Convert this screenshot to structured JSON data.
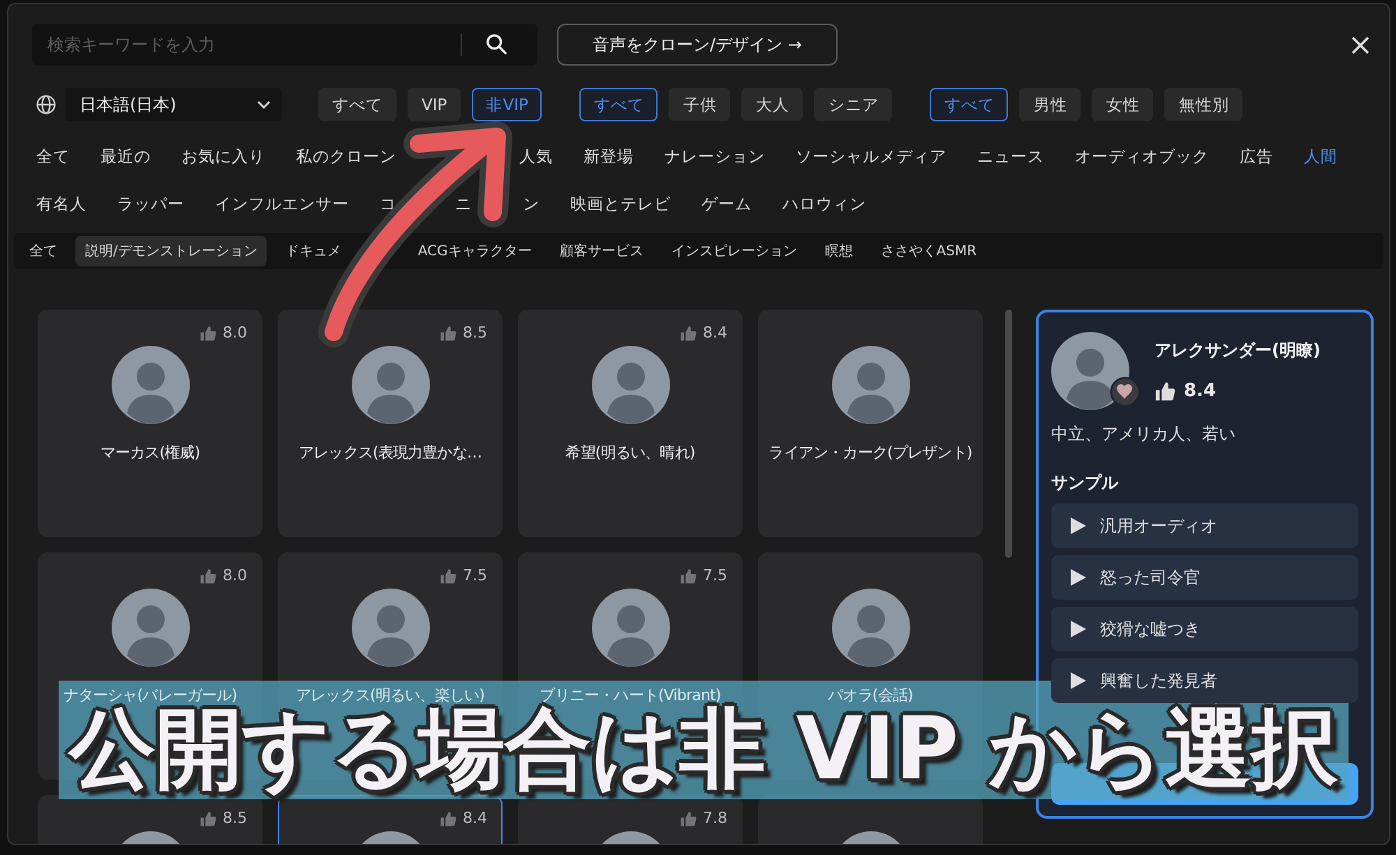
{
  "search": {
    "placeholder": "検索キーワードを入力"
  },
  "clone_button": {
    "label": "音声をクローン/デザイン →"
  },
  "language": {
    "value": "日本語(日本)"
  },
  "filter_groups": [
    {
      "chips": [
        {
          "label": "すべて",
          "selected": false
        },
        {
          "label": "VIP",
          "selected": false
        },
        {
          "label": "非VIP",
          "selected": true
        }
      ]
    },
    {
      "chips": [
        {
          "label": "すべて",
          "selected": true
        },
        {
          "label": "子供",
          "selected": false
        },
        {
          "label": "大人",
          "selected": false
        },
        {
          "label": "シニア",
          "selected": false
        }
      ]
    },
    {
      "chips": [
        {
          "label": "すべて",
          "selected": true
        },
        {
          "label": "男性",
          "selected": false
        },
        {
          "label": "女性",
          "selected": false
        },
        {
          "label": "無性別",
          "selected": false
        }
      ]
    }
  ],
  "category_rows": [
    {
      "items": [
        {
          "label": "全て",
          "selected": false
        },
        {
          "label": "最近の",
          "selected": false
        },
        {
          "label": "お気に入り",
          "selected": false
        },
        {
          "parts": [
            "私のクローン"
          ],
          "selected": false
        },
        {
          "label": "人気",
          "selected": false
        },
        {
          "label": "新登場",
          "selected": false
        },
        {
          "label": "ナレーション",
          "selected": false
        },
        {
          "label": "ソーシャルメディア",
          "selected": false
        },
        {
          "label": "ニュース",
          "selected": false
        },
        {
          "label": "オーディオブック",
          "selected": false
        },
        {
          "label": "広告",
          "selected": false
        },
        {
          "label": "人間",
          "selected": true
        }
      ]
    },
    {
      "items": [
        {
          "label": "有名人",
          "selected": false
        },
        {
          "label": "ラッパー",
          "selected": false
        },
        {
          "label": "インフルエンサー",
          "selected": false
        },
        {
          "parts": [
            "コ",
            "ニ",
            "ン"
          ],
          "selected": false
        },
        {
          "label": "映画とテレビ",
          "selected": false
        },
        {
          "label": "ゲーム",
          "selected": false
        },
        {
          "label": "ハロウィン",
          "selected": false
        }
      ]
    }
  ],
  "subcategories": [
    {
      "label": "全て",
      "selected": false
    },
    {
      "label": "説明/デモンストレーション",
      "selected": true
    },
    {
      "parts": [
        "ドキュメ"
      ],
      "selected": false
    },
    {
      "label": "ACGキャラクター",
      "selected": false
    },
    {
      "label": "顧客サービス",
      "selected": false
    },
    {
      "label": "インスピレーション",
      "selected": false
    },
    {
      "label": "瞑想",
      "selected": false
    },
    {
      "label": "ささやくASMR",
      "selected": false
    }
  ],
  "voice_cards": [
    {
      "name": "マーカス(権威)",
      "rating": "8.0",
      "selected": false
    },
    {
      "name": "アレックス(表現力豊かな…",
      "rating": "8.5",
      "selected": false
    },
    {
      "name": "希望(明るい、晴れ)",
      "rating": "8.4",
      "selected": false
    },
    {
      "name": "ライアン・カーク(プレザント)",
      "selected": false
    },
    {
      "name": "ナターシャ(バレーガール)",
      "rating": "8.0",
      "selected": false
    },
    {
      "name": "アレックス(明るい、楽しい)",
      "rating": "7.5",
      "selected": false
    },
    {
      "name": "ブリニー・ハート(Vibrant)",
      "rating": "7.5",
      "selected": false
    },
    {
      "name": "パオラ(会話)",
      "selected": false
    },
    {
      "rating": "8.5",
      "selected": false
    },
    {
      "rating": "8.4",
      "selected": true
    },
    {
      "rating": "7.8",
      "selected": false
    },
    {
      "selected": false
    }
  ],
  "detail_panel": {
    "name": "アレクサンダー(明瞭)",
    "rating": "8.4",
    "description": "中立、アメリカ人、若い",
    "samples_heading": "サンプル",
    "samples": [
      {
        "label": "汎用オーディオ"
      },
      {
        "label": "怒った司令官"
      },
      {
        "label": "狡猾な嘘つき"
      },
      {
        "label": "興奮した発見者"
      }
    ]
  },
  "annotation": {
    "caption": "公開する場合は非 VIP から選択"
  }
}
